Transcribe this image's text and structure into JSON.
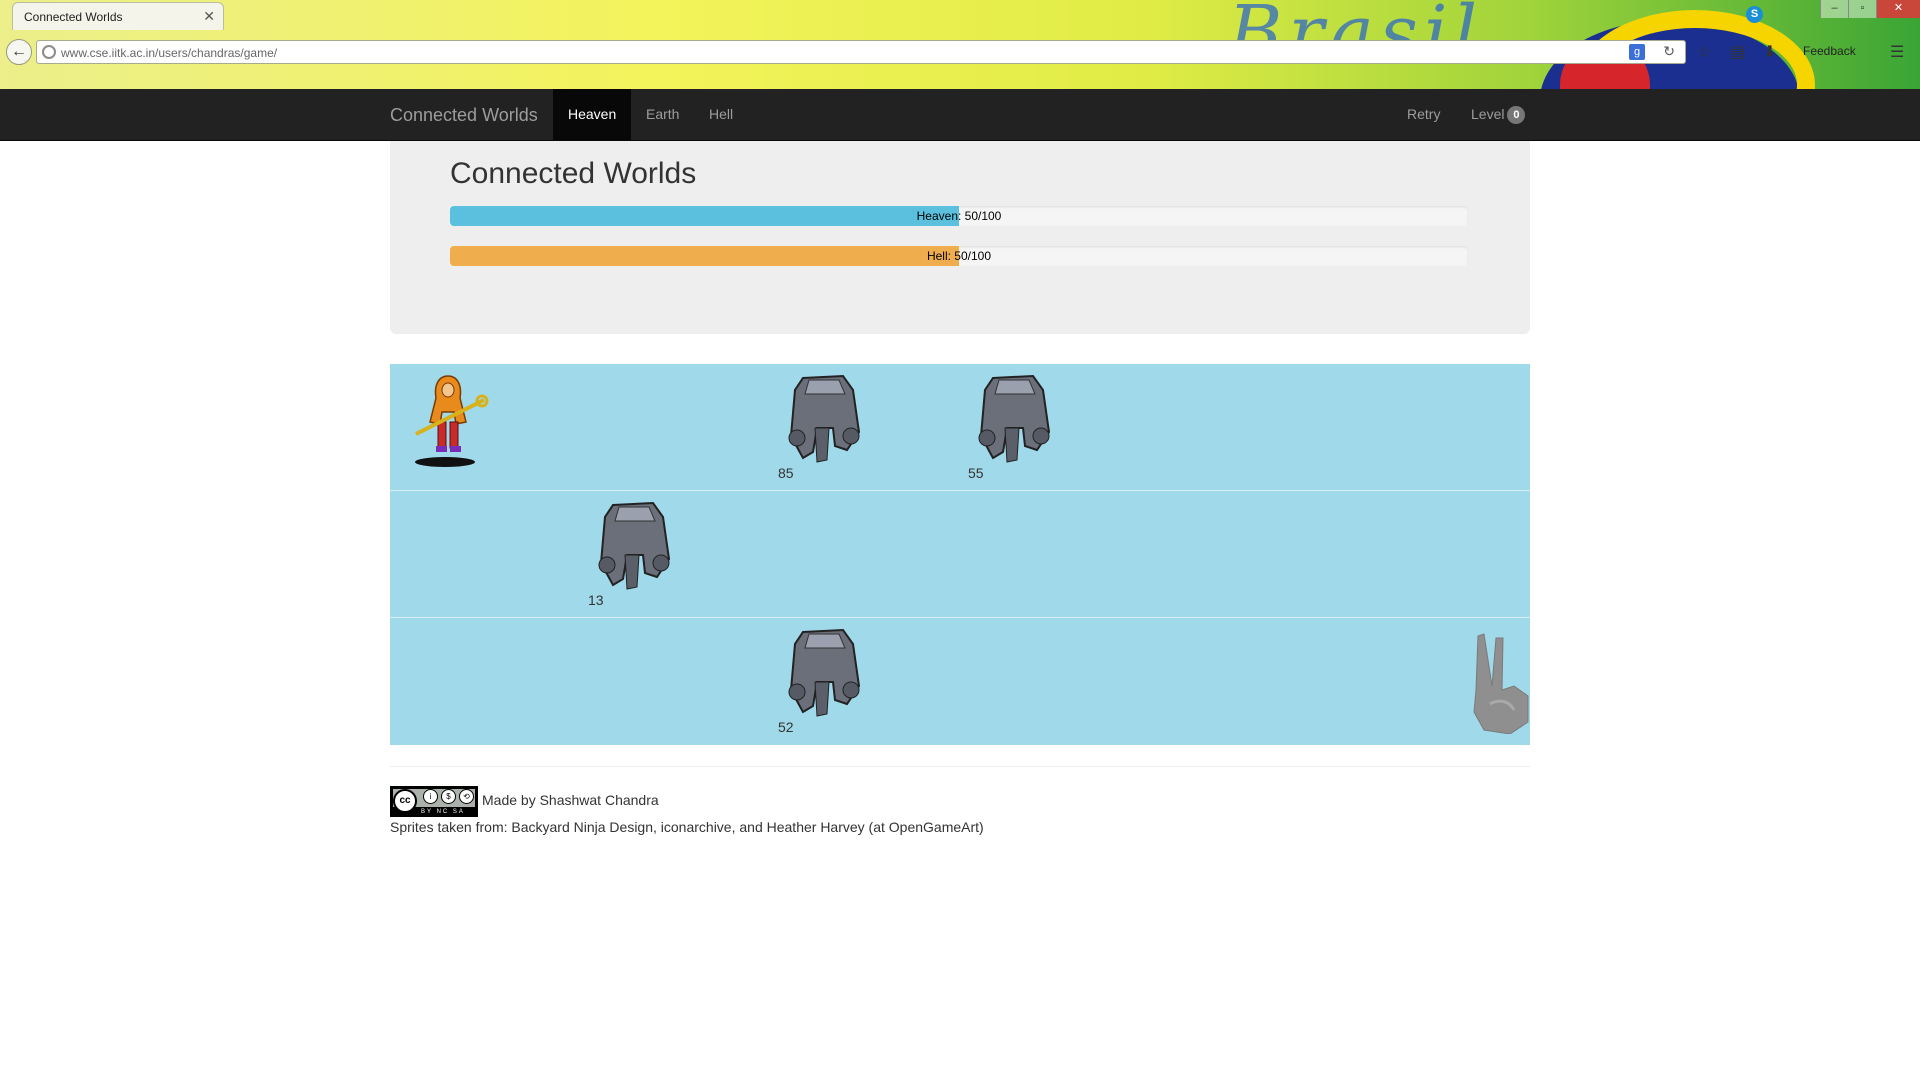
{
  "browser": {
    "tab_title": "Connected Worlds",
    "url": "www.cse.iitk.ac.in/users/chandras/game/",
    "feedback_label": "Feedback",
    "theme_text": "Brasil"
  },
  "navbar": {
    "brand": "Connected Worlds",
    "tabs": [
      {
        "label": "Heaven",
        "active": true
      },
      {
        "label": "Earth",
        "active": false
      },
      {
        "label": "Hell",
        "active": false
      }
    ],
    "retry_label": "Retry",
    "level_label": "Level",
    "level_value": "0"
  },
  "jumbotron": {
    "title": "Connected Worlds",
    "heaven_bar": {
      "text": "Heaven: 50/100",
      "value": 50,
      "max": 100,
      "color": "#5bc0de"
    },
    "hell_bar": {
      "text": "Hell: 50/100",
      "value": 50,
      "max": 100,
      "color": "#f0ad4e"
    }
  },
  "board": {
    "background": "#a0d9ea",
    "player": {
      "lane": 0,
      "icon": "warrior-girl-with-spear-sprite"
    },
    "golems": [
      {
        "lane": 0,
        "label": "85"
      },
      {
        "lane": 0,
        "label": "55"
      },
      {
        "lane": 1,
        "label": "13"
      },
      {
        "lane": 2,
        "label": "52"
      }
    ],
    "goal_icon": "peace-hand-icon"
  },
  "footer": {
    "license": "CC BY NC SA",
    "license_by": "BY",
    "license_nc": "NC",
    "license_sa": "SA",
    "made_by": "Made by Shashwat Chandra",
    "sprites_credit": "Sprites taken from: Backyard Ninja Design, iconarchive, and Heather Harvey (at OpenGameArt)"
  }
}
